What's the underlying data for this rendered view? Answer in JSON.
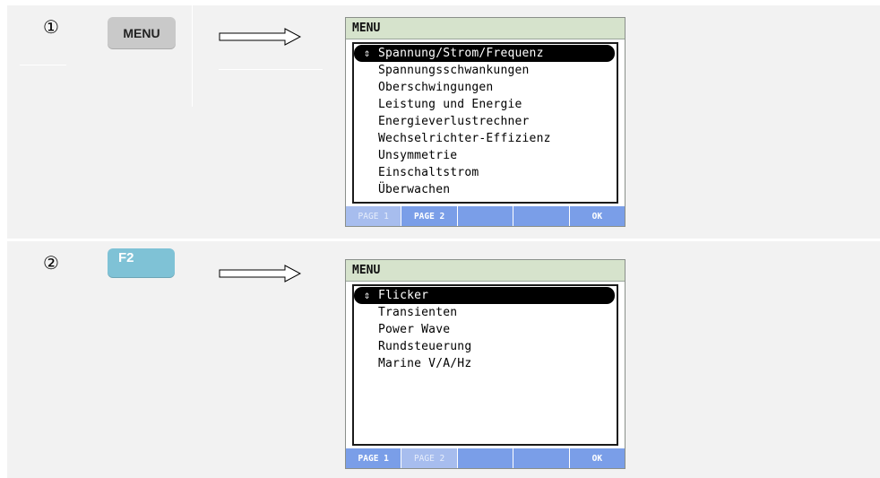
{
  "colors": {
    "screen_header": "#d6e3cc",
    "softkey_active": "#7a9ee8",
    "softkey_inactive": "#a7bdee",
    "softkey_inactive_text": "#e6edfb",
    "menu_key": "#c9c9c9",
    "f2_key": "#7fc2d6"
  },
  "steps": [
    {
      "number": "①",
      "key": {
        "label": "MENU",
        "icon": "menu-key"
      },
      "arrow_icon": "right-arrow-icon",
      "screen": {
        "title": "MENU",
        "items": [
          "Spannung/Strom/Frequenz",
          "Spannungsschwankungen",
          "Oberschwingungen",
          "Leistung und Energie",
          "Energieverlustrechner",
          "Wechselrichter-Effizienz",
          "Unsymmetrie",
          "Einschaltstrom",
          "Überwachen"
        ],
        "selected_index": 0,
        "softkeys": [
          {
            "label": "PAGE 1",
            "active": false
          },
          {
            "label": "PAGE 2",
            "active": true
          },
          {
            "label": "",
            "active": true
          },
          {
            "label": "",
            "active": true
          },
          {
            "label": "OK",
            "active": true
          }
        ]
      }
    },
    {
      "number": "②",
      "key": {
        "label": "F2",
        "icon": "function-key"
      },
      "arrow_icon": "right-arrow-icon",
      "screen": {
        "title": "MENU",
        "items": [
          "Flicker",
          "Transienten",
          "Power Wave",
          "Rundsteuerung",
          "Marine V/A/Hz"
        ],
        "selected_index": 0,
        "softkeys": [
          {
            "label": "PAGE 1",
            "active": true
          },
          {
            "label": "PAGE 2",
            "active": false
          },
          {
            "label": "",
            "active": true
          },
          {
            "label": "",
            "active": true
          },
          {
            "label": "OK",
            "active": true
          }
        ]
      }
    }
  ]
}
